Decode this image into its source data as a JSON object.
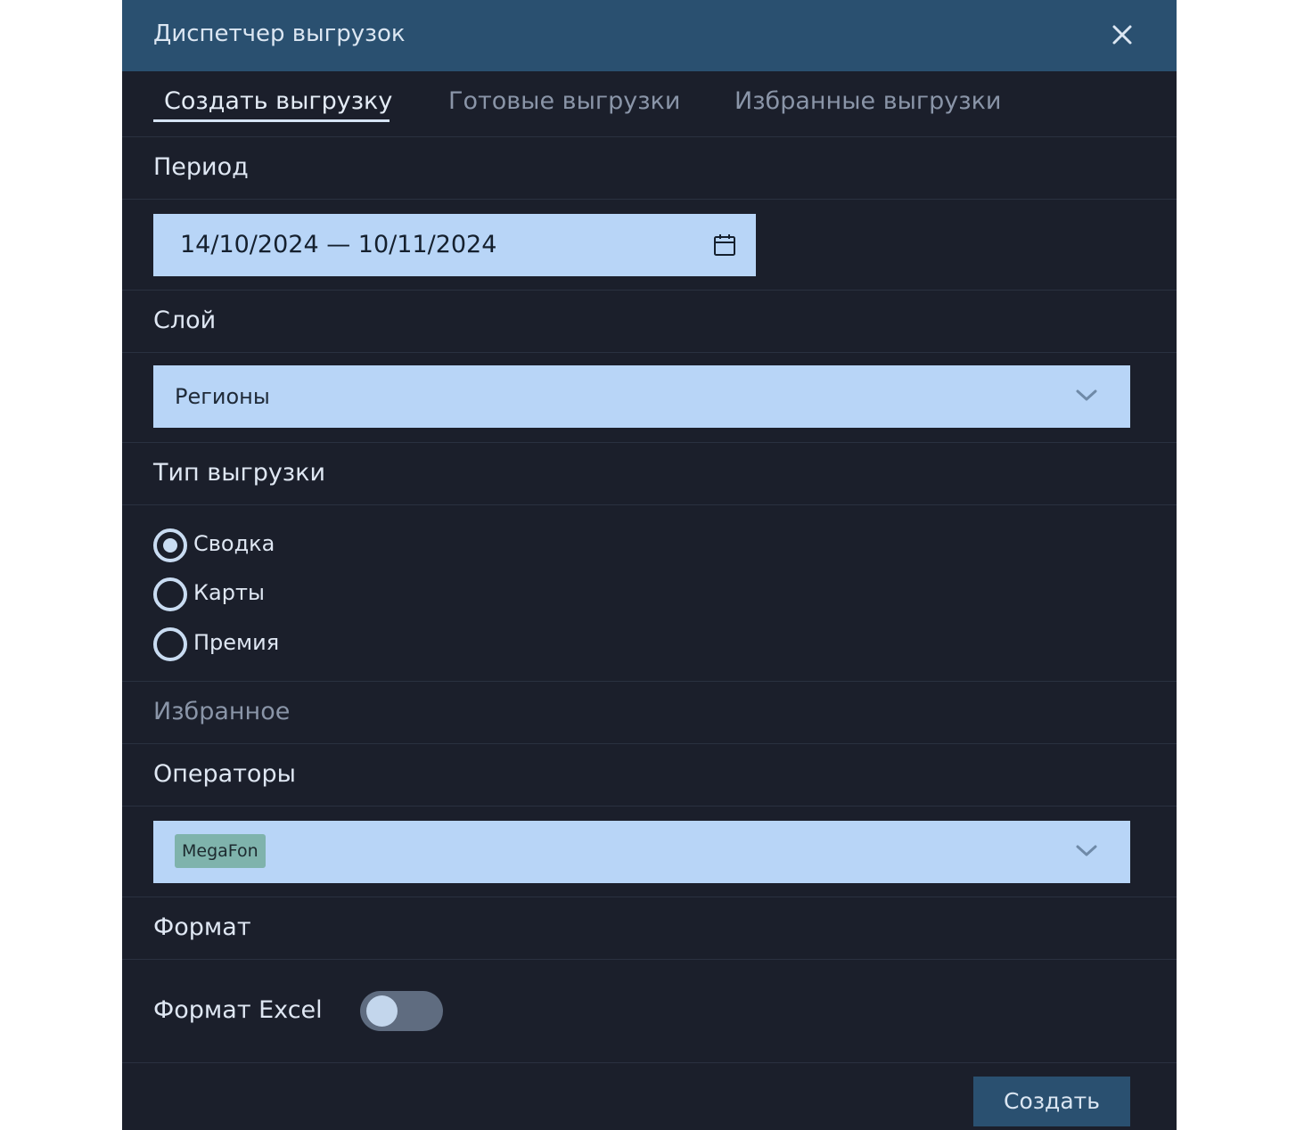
{
  "dialog": {
    "title": "Диспетчер выгрузок"
  },
  "tabs": [
    {
      "label": "Создать выгрузку",
      "active": true
    },
    {
      "label": "Готовые выгрузки",
      "active": false
    },
    {
      "label": "Избранные выгрузки",
      "active": false
    }
  ],
  "period": {
    "label": "Период",
    "value": "14/10/2024 — 10/11/2024"
  },
  "layer": {
    "label": "Слой",
    "value": "Регионы"
  },
  "export_type": {
    "label": "Тип выгрузки",
    "options": [
      {
        "label": "Сводка",
        "selected": true
      },
      {
        "label": "Карты",
        "selected": false
      },
      {
        "label": "Премия",
        "selected": false
      }
    ]
  },
  "favorites": {
    "label": "Избранное"
  },
  "operators": {
    "label": "Операторы",
    "selected": [
      "MegaFon"
    ]
  },
  "format": {
    "label": "Формат",
    "excel_label": "Формат Excel",
    "excel_enabled": false
  },
  "actions": {
    "create_label": "Создать"
  },
  "colors": {
    "header_bg": "#2a5070",
    "panel_bg": "#1b1f2b",
    "input_bg": "#b8d5f7",
    "chip_bg": "#7fb3ac"
  }
}
